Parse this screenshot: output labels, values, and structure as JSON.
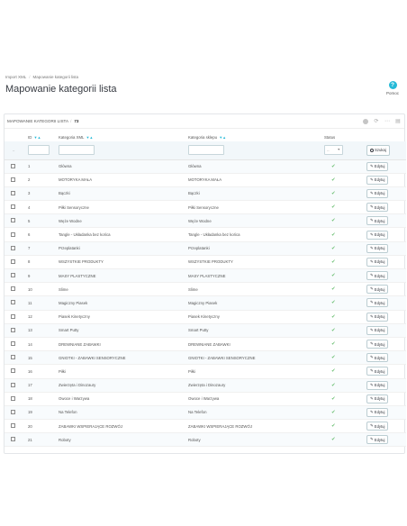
{
  "breadcrumb": [
    "Import XML",
    "Mapowanie kategorii lista"
  ],
  "page_title": "Mapowanie kategorii lista",
  "help_label": "Pomoc",
  "panel": {
    "title": "Mapowanie kategorii lista",
    "count": "73"
  },
  "columns": {
    "id": "ID",
    "xml": "Kategoria XML",
    "shop": "Kategoria sklepu",
    "status": "Status"
  },
  "filters": {
    "id_placeholder": "--",
    "status_value": "--",
    "search_label": "Szukaj"
  },
  "edit_label": "Edytuj",
  "rows": [
    {
      "id": "1",
      "xml": "Główna",
      "shop": "Główna"
    },
    {
      "id": "2",
      "xml": "MOTORYKA MAŁA",
      "shop": "MOTORYKA MAŁA"
    },
    {
      "id": "3",
      "xml": "Bączki",
      "shop": "Bączki"
    },
    {
      "id": "4",
      "xml": "Piłki Sensoryczne",
      "shop": "Piłki Sensoryczne"
    },
    {
      "id": "5",
      "xml": "Węże Wodne",
      "shop": "Węże Wodne"
    },
    {
      "id": "6",
      "xml": "Tangle - Układanka bez końca",
      "shop": "Tangle - Układanka bez końca"
    },
    {
      "id": "7",
      "xml": "Przeplatanki",
      "shop": "Przeplatanki"
    },
    {
      "id": "8",
      "xml": "WSZYSTKIE PRODUKTY",
      "shop": "WSZYSTKIE PRODUKTY"
    },
    {
      "id": "9",
      "xml": "MASY PLASTYCZNE",
      "shop": "MASY PLASTYCZNE"
    },
    {
      "id": "10",
      "xml": "Slime",
      "shop": "Slime"
    },
    {
      "id": "11",
      "xml": "Magiczny Piasek",
      "shop": "Magiczny Piasek"
    },
    {
      "id": "12",
      "xml": "Piasek Kinetyczny",
      "shop": "Piasek Kinetyczny"
    },
    {
      "id": "13",
      "xml": "Smart Putty",
      "shop": "Smart Putty"
    },
    {
      "id": "14",
      "xml": "DREWNIANE ZABAWKI",
      "shop": "DREWNIANE ZABAWKI"
    },
    {
      "id": "15",
      "xml": "GNIOTKI - ZABAWKI SENSORYCZNE",
      "shop": "GNIOTKI - ZABAWKI SENSORYCZNE"
    },
    {
      "id": "16",
      "xml": "Piłki",
      "shop": "Piłki"
    },
    {
      "id": "17",
      "xml": "Zwierzęta i Dinozaury",
      "shop": "Zwierzęta i Dinozaury"
    },
    {
      "id": "18",
      "xml": "Owoce i Warzywa",
      "shop": "Owoce i Warzywa"
    },
    {
      "id": "19",
      "xml": "Na Telefon",
      "shop": "Na Telefon"
    },
    {
      "id": "20",
      "xml": "ZABAWKI WSPIERAJĄCE ROZWÓJ",
      "shop": "ZABAWKI WSPIERAJĄCE ROZWÓJ"
    },
    {
      "id": "21",
      "xml": "Roboty",
      "shop": "Roboty"
    }
  ],
  "colors": {
    "accent": "#25b9d7",
    "status_ok": "#72c279"
  }
}
